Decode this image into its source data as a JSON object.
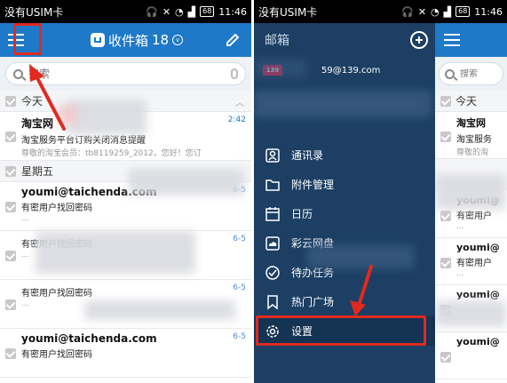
{
  "status": {
    "carrier": "没有USIM卡",
    "time": "11:46",
    "battery": "68"
  },
  "left": {
    "title": "收件箱",
    "unread_count": "18",
    "search_placeholder": "搜索",
    "sections": [
      "今天",
      "星期五"
    ],
    "mails": [
      {
        "sender": "淘宝网",
        "subject": "淘宝服务平台订购关闭消息提醒",
        "preview": "尊敬的淘宝会员：tb8119259_2012，您好！您订",
        "time": "2:42"
      },
      {
        "sender": "youmi@taichenda.com",
        "subject": "有密用户找回密码",
        "preview": "...",
        "time": "6-5"
      },
      {
        "sender": "",
        "subject": "有密用户找回密码",
        "preview": "...",
        "time": "6-5"
      },
      {
        "sender": "",
        "subject": "有密用户找回密码",
        "preview": "...",
        "time": "6-5"
      },
      {
        "sender": "youmi@taichenda.com",
        "subject": "有密用户找回密码",
        "preview": "",
        "time": "6-5"
      }
    ]
  },
  "drawer": {
    "title": "邮箱",
    "account_logo": "139",
    "account_email": "59@139.com",
    "menu": [
      {
        "label": "通讯录",
        "icon": "contacts-icon"
      },
      {
        "label": "附件管理",
        "icon": "folder-icon"
      },
      {
        "label": "日历",
        "icon": "calendar-icon"
      },
      {
        "label": "彩云网盘",
        "icon": "cloud-icon"
      },
      {
        "label": "待办任务",
        "icon": "task-check-icon"
      },
      {
        "label": "热门广场",
        "icon": "bookmark-icon"
      },
      {
        "label": "设置",
        "icon": "settings-gear-icon"
      }
    ]
  },
  "right": {
    "search_placeholder": "搜索",
    "section": "今天",
    "mails": [
      {
        "sender": "淘宝网",
        "subject": "淘宝服务",
        "preview": "尊敬的淘"
      },
      {
        "sender": "",
        "subject": "",
        "preview": ""
      },
      {
        "sender": "youmi@",
        "subject": "有密用户",
        "preview": "..."
      },
      {
        "sender": "youmi@",
        "subject": "有密用户",
        "preview": "..."
      },
      {
        "sender": "youmi@",
        "subject": "",
        "preview": ""
      },
      {
        "sender": "youmi@",
        "subject": "",
        "preview": ""
      }
    ]
  },
  "colors": {
    "primary": "#1e79c8",
    "drawer_bg": "#1c3f63",
    "highlight": "#e02a1e"
  }
}
